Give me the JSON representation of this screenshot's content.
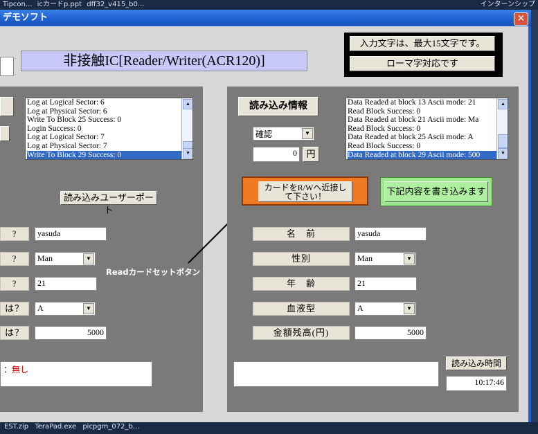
{
  "desktop": {
    "top_items": [
      "Tipcon...",
      "icカードp.ppt",
      "dff32_v415_b0..."
    ],
    "top_right": "インターンシップ",
    "bottom_items": [
      "EST.zip",
      "TeraPad.exe",
      "picpgm_072_b..."
    ]
  },
  "window": {
    "title": "デモソフト",
    "close_symbol": "✕"
  },
  "header": {
    "title": "非接触IC[Reader/Writer(ACR120)]",
    "note_line1": "入力文字は、最大15文字です。",
    "note_line2": "ローマ字対応です"
  },
  "left": {
    "log": [
      "Log at Logical Sector: 6",
      "Log at Physical Sector: 6",
      "Write To Block 25 Success: 0",
      "Login Success: 0",
      "Log at Logical Sector: 7",
      "Log at Physical Sector: 7",
      "Write To Block 29 Success: 0"
    ],
    "support_button": "読み込みユーザーポート",
    "fields": [
      {
        "label": "?",
        "value": "yasuda",
        "kind": "text"
      },
      {
        "label": "?",
        "value": "Man",
        "kind": "select"
      },
      {
        "label": "?",
        "value": "21",
        "kind": "text"
      },
      {
        "label": "は？",
        "value": "A",
        "kind": "select"
      },
      {
        "label": "は？",
        "value": "5000",
        "kind": "number"
      }
    ],
    "status_prefix": "：",
    "status_value": "無し"
  },
  "right": {
    "read_info_button": "読み込み情報",
    "log": [
      "Data Readed at block 13 Ascii mode: 21",
      "Read Block Success: 0",
      "Data Readed at block 21 Ascii mode: Ma",
      "Read Block Success: 0",
      "Data Readed at block 25 Ascii mode: A",
      "Read Block Success: 0",
      "Data Readed at block 29 Ascii mode: 500"
    ],
    "confirm_select": "確認",
    "amount_value": "0",
    "amount_unit": "円",
    "card_button_line1": "カードをR/Wへ近接し",
    "card_button_line2": "て下さい！",
    "write_button": "下記内容を書き込みます",
    "fields": [
      {
        "label": "名　前",
        "value": "yasuda",
        "kind": "text"
      },
      {
        "label": "性別",
        "value": "Man",
        "kind": "select"
      },
      {
        "label": "年　齢",
        "value": "21",
        "kind": "text"
      },
      {
        "label": "血液型",
        "value": "A",
        "kind": "select"
      },
      {
        "label": "金額残高(円)",
        "value": "5000",
        "kind": "number"
      }
    ],
    "read_time_button": "読み込み時間",
    "time_value": "10:17:46"
  },
  "annotation": {
    "text": "Readカードセットボタン",
    "ellipse_color": "#ffffff",
    "arrow_color": "#000000"
  },
  "colors": {
    "highlight_orange": "#f07820",
    "write_green": "#9be88c",
    "title_lavender": "#c8c8f8",
    "error_red": "#d00000"
  }
}
